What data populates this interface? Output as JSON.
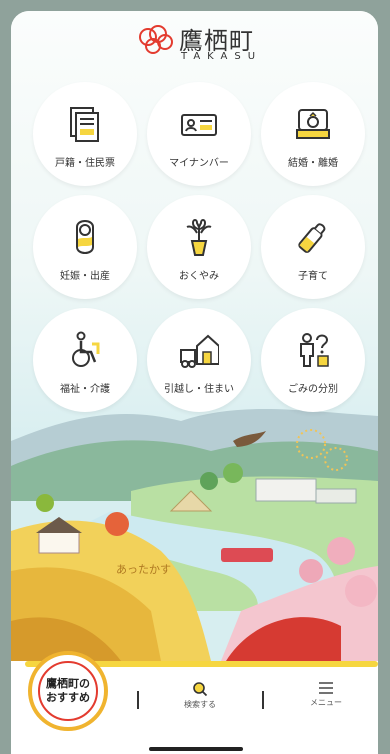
{
  "header": {
    "title": "鷹栖町",
    "subtitle": "TAKASU"
  },
  "menu": {
    "tiles": [
      {
        "label": "戸籍・住民票",
        "icon": "document-icon"
      },
      {
        "label": "マイナンバー",
        "icon": "id-card-icon"
      },
      {
        "label": "結婚・離婚",
        "icon": "ring-box-icon"
      },
      {
        "label": "妊娠・出産",
        "icon": "baby-icon"
      },
      {
        "label": "おくやみ",
        "icon": "flower-icon"
      },
      {
        "label": "子育て",
        "icon": "baby-bottle-icon"
      },
      {
        "label": "福祉・介護",
        "icon": "wheelchair-icon"
      },
      {
        "label": "引越し・住まい",
        "icon": "moving-truck-icon"
      },
      {
        "label": "ごみの分別",
        "icon": "trash-sorting-icon"
      }
    ]
  },
  "scene": {
    "sign_text": "あったかす"
  },
  "bottom_nav": {
    "recommend_line1": "鷹栖町の",
    "recommend_line2": "おすすめ",
    "search_label": "検索する",
    "menu_label": "メニュー"
  },
  "colors": {
    "accent_yellow": "#f6d640",
    "accent_red": "#e33b2f",
    "outline": "#333333"
  }
}
